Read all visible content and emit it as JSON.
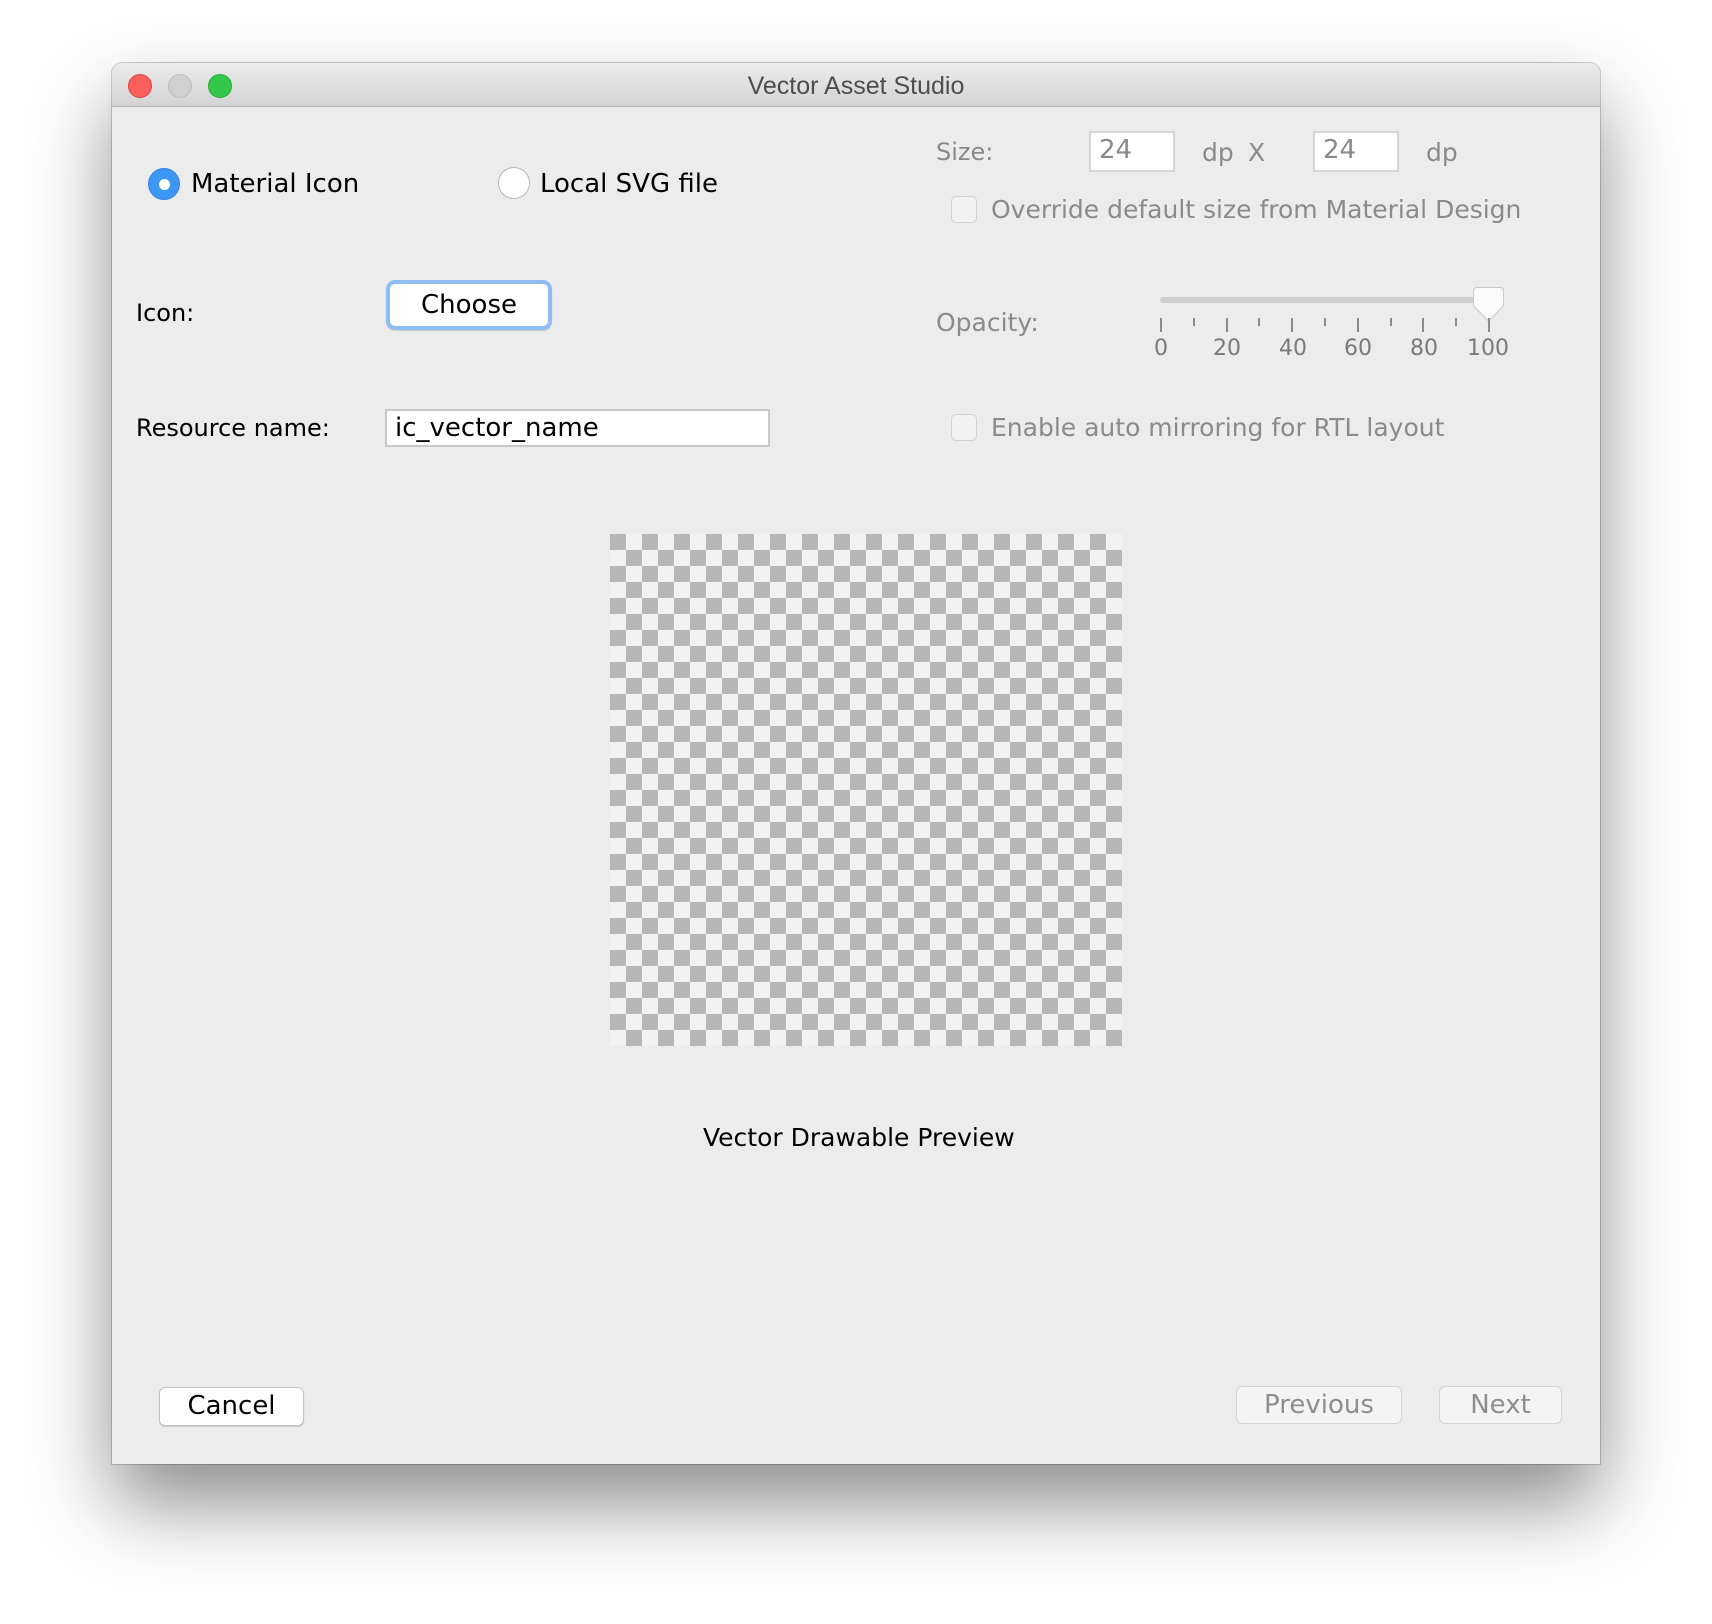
{
  "window": {
    "title": "Vector Asset Studio",
    "controls": [
      "close",
      "minimize",
      "zoom"
    ]
  },
  "source_type": {
    "options": [
      {
        "label": "Material Icon",
        "selected": true
      },
      {
        "label": "Local SVG file",
        "selected": false
      }
    ]
  },
  "icon": {
    "label": "Icon:",
    "choose_button": "Choose"
  },
  "resource_name": {
    "label": "Resource name:",
    "value": "ic_vector_name"
  },
  "size": {
    "label": "Size:",
    "width_value": "24",
    "height_value": "24",
    "unit_1": "dp",
    "separator": "X",
    "unit_2": "dp",
    "override_label": "Override default size from Material Design",
    "override_checked": false
  },
  "opacity": {
    "label": "Opacity:",
    "value_percent": 100,
    "min": 0,
    "max": 100,
    "tick_labels": [
      "0",
      "20",
      "40",
      "60",
      "80",
      "100"
    ]
  },
  "auto_mirror": {
    "label": "Enable auto mirroring for RTL layout",
    "checked": false
  },
  "preview": {
    "caption": "Vector Drawable Preview"
  },
  "footer": {
    "cancel": "Cancel",
    "previous": "Previous",
    "next": "Next"
  },
  "colors": {
    "accent": "#3d97f5",
    "focus_ring": "#8fbcf2",
    "window_bg": "#ececec",
    "checker_dark": "#b7b7b7",
    "checker_light": "#f2f2f2"
  }
}
